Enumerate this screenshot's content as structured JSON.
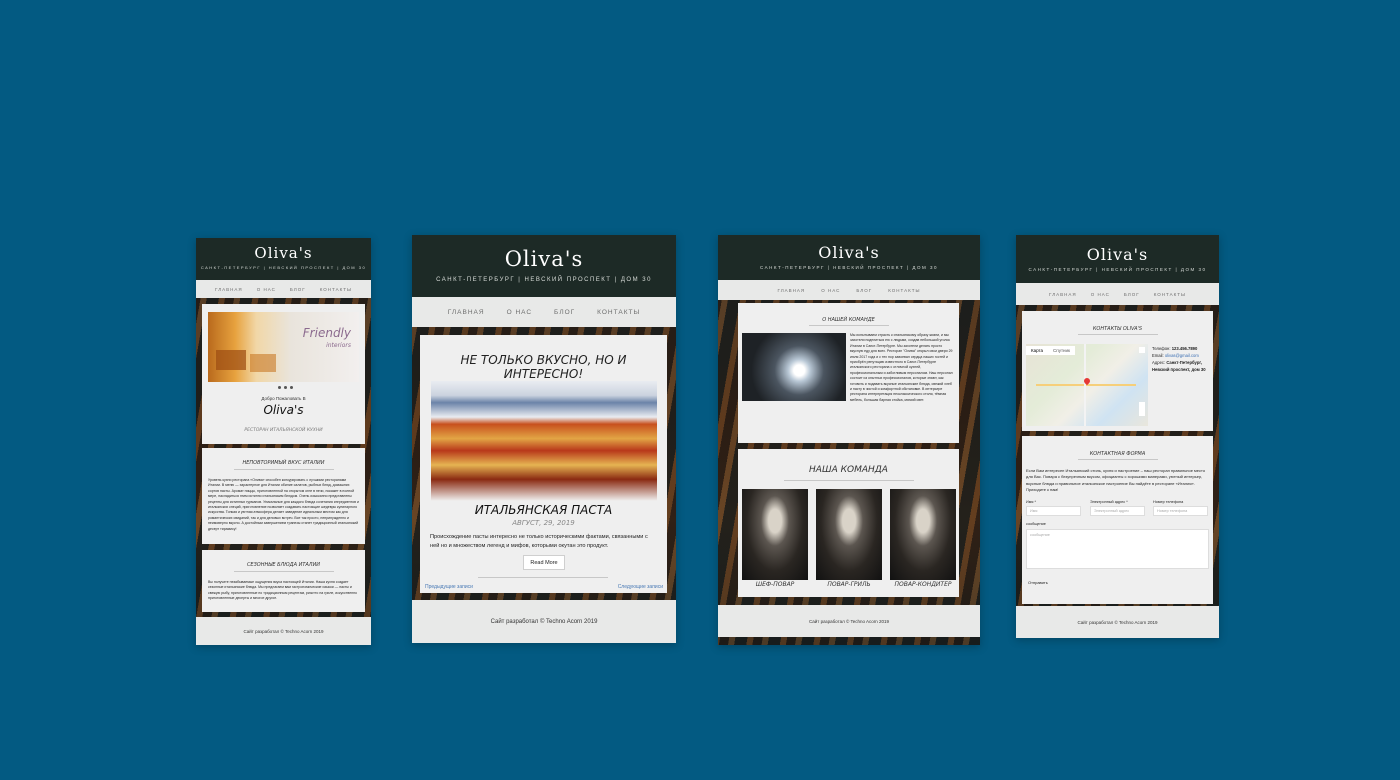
{
  "brand": {
    "name": "Oliva's",
    "address": "САНКТ-ПЕТЕРБУРГ | НЕВСКИЙ ПРОСПЕКТ | ДОМ 30"
  },
  "nav": {
    "home": "ГЛАВНАЯ",
    "about": "О НАС",
    "blog": "БЛОГ",
    "contacts": "КОНТАКТЫ"
  },
  "footer": "Сайт разработал © Techno Acorn 2019",
  "mock1": {
    "slider_text_1": "Friendly",
    "slider_text_2": "interiors",
    "welcome": "Добро Пожаловать В",
    "welcome_name": "Oliva's",
    "subtitle": "РЕСТОРАН ИТАЛЬЯНСКОЙ КУХНИ",
    "section1_title": "НЕПОВТОРИМЫЙ ВКУС ИТАЛИИ",
    "section1_text": "Уровень кухни ресторана «Олива» способен конкурировать с лучшими ресторанами Италии. В меню — характерное для Италии обилие салатов, рыбных блюд, домашних сортов пасты. Аромат пиццы, приготовленной на открытом огне в печи, покажет в полной мере, насладиться этим истинно итальянским блюдом. Очень изысканно представлены рецепты для истинных гурманов. Уникальные для каждого блюда сочетания ингредиентов и итальянских специй, приготовление позволяет создавать настоящие шедевры кулинарного искусства. Тонкая и уютная атмосфера делает заведение идеальным местом как для романтических свиданий, так и для деловых встреч. Все так просто, непринужденно и неимоверно вкусно. А достойным завершением трапезы станет традиционный итальянский десерт тирамису!",
    "section2_title": "СЕЗОННЫЕ БЛЮДА ИТАЛИИ",
    "section2_text": "Вы получите незабываемые ощущения вкуса настоящей Италии. Наша кухня создает сезонные итальянские блюда. Мы предлагаем вам гастрономические изыски — пасты и свежую рыбу, приготовленные по традиционным рецептам, ризотто на гриле, искусственно приготовленные десерты и многое другое."
  },
  "mock2": {
    "headline": "НЕ ТОЛЬКО ВКУСНО, НО И ИНТЕРЕСНО!",
    "post_title": "ИТАЛЬЯНСКАЯ ПАСТА",
    "post_date": "АВГУСТ, 29, 2019",
    "post_text": "Происхождение пасты интересно не только историческими фактами, связанными с ней но и множеством легенд и мифов, которыми окутан это продукт.",
    "read_more": "Read More",
    "prev": "Предыдущие записи",
    "next": "Следующие записи"
  },
  "mock3": {
    "about_title": "О НАШЕЙ КОМАНДЕ",
    "about_text": "Мы испытываем страсть к итальянскому образу жизни, и мы захотели поделиться ею с людьми, создав небольшой уголок Италии в Санкт-Петербурге. Мы захотели делать просто вкусную еду для всех. Ресторан \"Олива\" открыл свои двери 29 июля 2017 года и с тех пор завоевал сердца наших гостей и приобрёл репутацию известного в Санкт-Петербурге итальянского ресторана с отличной кухней, профессиональным и заботливым персоналом. Наш персонал состоит из опытных профессионалов, которые знают, как готовить и подавать вкусные итальянские блюда, свежий хлеб и пасту в чистой и комфортной обстановке. В интерьере ресторана интерпретация неоклассического стиля, тёмная мебель, большая барная стойка, мягкий свет.",
    "team_title": "НАША КОМАНДА",
    "team": [
      "ШЕФ-ПОВАР",
      "ПОВАР-ГРИЛЬ",
      "ПОВАР-КОНДИТЕР"
    ]
  },
  "mock4": {
    "contacts_title": "КОНТАКТЫ OLIVA'S",
    "map_tab_1": "Карта",
    "map_tab_2": "Спутник",
    "phone_label": "Телефон:",
    "phone": "123.456.7890",
    "email_label": "Email:",
    "email": "olivas@gmail.com",
    "address_label": "Адрес:",
    "address": "Санкт-Петербург, Невский проспект, дом 30",
    "form_title": "КОНТАКТНАЯ ФОРМА",
    "form_intro": "Если Вам интересен Итальянский стиль, кухня и настроение – наш ресторан правильное место для Вас. Повара с безупречным вкусом, официанты с хорошими манерами, уютный интерьер, вкусные блюда и правильное итальянское настроение Вы найдёте в ресторане «Италия». Приходите к нам!",
    "name_label": "Имя *",
    "name_ph": "Имя",
    "email_field_label": "Электронный адрес *",
    "email_ph": "Электронный адрес",
    "phone_field_label": "Номер телефона",
    "phone_ph": "Номер телефона",
    "message_label": "сообщение",
    "message_ph": "сообщение",
    "submit": "Отправить"
  },
  "colors": {
    "page_bg": "#035a82",
    "header": "#1d2a26",
    "nav": "#e8e9e8",
    "card": "#efefef"
  }
}
